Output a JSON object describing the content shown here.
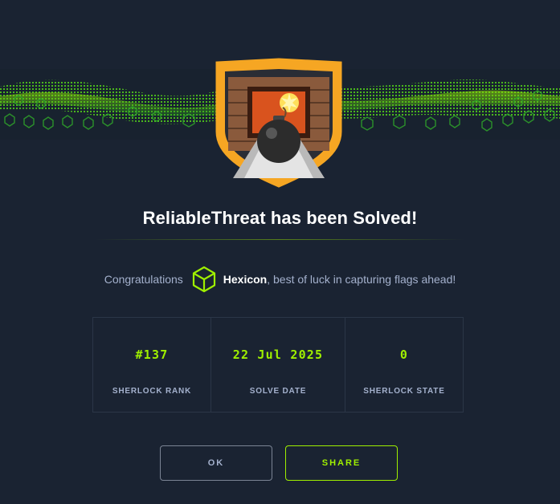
{
  "dialog": {
    "title": "ReliableThreat has been Solved!",
    "congrats_prefix": "Congratulations",
    "username": "Hexicon",
    "congrats_suffix": ", best of luck in capturing flags ahead!"
  },
  "stats": [
    {
      "value": "#137",
      "label": "SHERLOCK RANK"
    },
    {
      "value": "22 Jul 2025",
      "label": "SOLVE DATE"
    },
    {
      "value": "0",
      "label": "SHERLOCK STATE"
    }
  ],
  "buttons": {
    "ok": "OK",
    "share": "SHARE"
  },
  "icons": {
    "banner": "green-hex-wave-banner",
    "badge": "bomb-shield-badge-icon",
    "user": "htb-cube-icon"
  },
  "colors": {
    "background": "#1a2332",
    "accent": "#9fef00",
    "muted_text": "#a4b1cd",
    "badge_border": "#f6a623"
  }
}
